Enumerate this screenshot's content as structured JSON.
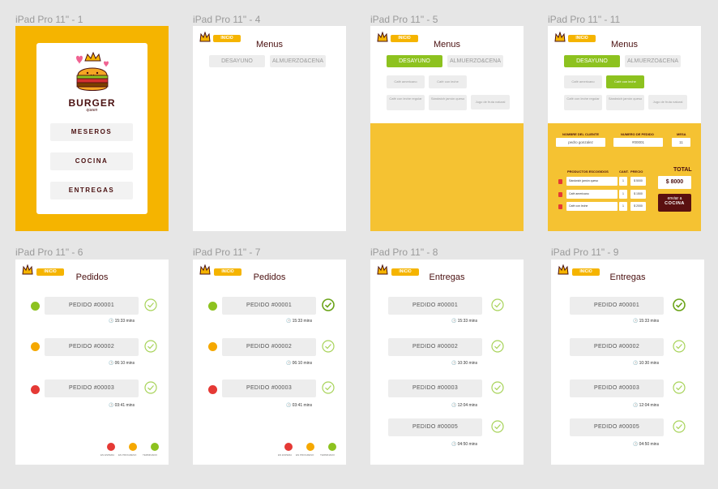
{
  "artboards": [
    {
      "label": "iPad Pro 11\" - 1"
    },
    {
      "label": "iPad Pro 11\" - 4"
    },
    {
      "label": "iPad Pro 11\" - 5"
    },
    {
      "label": "iPad Pro 11\" - 11"
    },
    {
      "label": "iPad Pro 11\" - 6"
    },
    {
      "label": "iPad Pro 11\" - 7"
    },
    {
      "label": "iPad Pro 11\" - 8"
    },
    {
      "label": "iPad Pro 11\" - 9"
    }
  ],
  "home": {
    "brand": "BURGER",
    "brand_sub": "queen",
    "buttons": [
      "MESEROS",
      "COCINA",
      "ENTREGAS"
    ]
  },
  "common": {
    "inicio": "INICIO",
    "menus_title": "Menus",
    "pedidos_title": "Pedidos",
    "entregas_title": "Entregas",
    "tab_desayuno": "DESAYUNO",
    "tab_almuerzo": "ALMUERZO&CENA"
  },
  "menu_items": [
    "Café americano",
    "Café con leche",
    "Café con leche regular",
    "Sándwich jamón queso",
    "Jugo de fruta natural"
  ],
  "order": {
    "client_label": "NOMBRE DEL CLIENTE",
    "client_value": "pedro gonzalez",
    "order_no_label": "NUMERO DE PEDIDO",
    "order_no_value": "#00001",
    "table_label": "MESA",
    "table_value": "11",
    "products_label": "PRODUCTOS ESCOGIDOS",
    "qty_label": "CANT.",
    "price_label": "PRECIO",
    "total_label": "TOTAL",
    "total_value": "$ 8000",
    "send_label_1": "enviar a",
    "send_label_2": "COCINA",
    "rows": [
      {
        "product": "Sándwich jamón queso",
        "qty": "1",
        "price": "$ 5000"
      },
      {
        "product": "Café americano",
        "qty": "1",
        "price": "$ 1500"
      },
      {
        "product": "Café con leche",
        "qty": "1",
        "price": "$ 2000"
      }
    ]
  },
  "pedidos": [
    {
      "label": "PEDIDO #00001",
      "time": "15:33 mins"
    },
    {
      "label": "PEDIDO #00002",
      "time": "06:10 mins"
    },
    {
      "label": "PEDIDO #00003",
      "time": "03:41 mins"
    }
  ],
  "entregas": [
    {
      "label": "PEDIDO #00001",
      "time": "15:33 mins"
    },
    {
      "label": "PEDIDO #00002",
      "time": "10:30 mins"
    },
    {
      "label": "PEDIDO #00003",
      "time": "12:04 mins"
    },
    {
      "label": "PEDIDO #00005",
      "time": "04:50 mins"
    }
  ],
  "legend": [
    "EN ESPERA",
    "EN PROGRESO",
    "TERMINADO"
  ],
  "colors": {
    "yellow": "#f5b400",
    "panel_yellow": "#f5c232",
    "green": "#8dc21f",
    "orange": "#f5a800",
    "red": "#e53935",
    "maroon": "#4a1010"
  }
}
